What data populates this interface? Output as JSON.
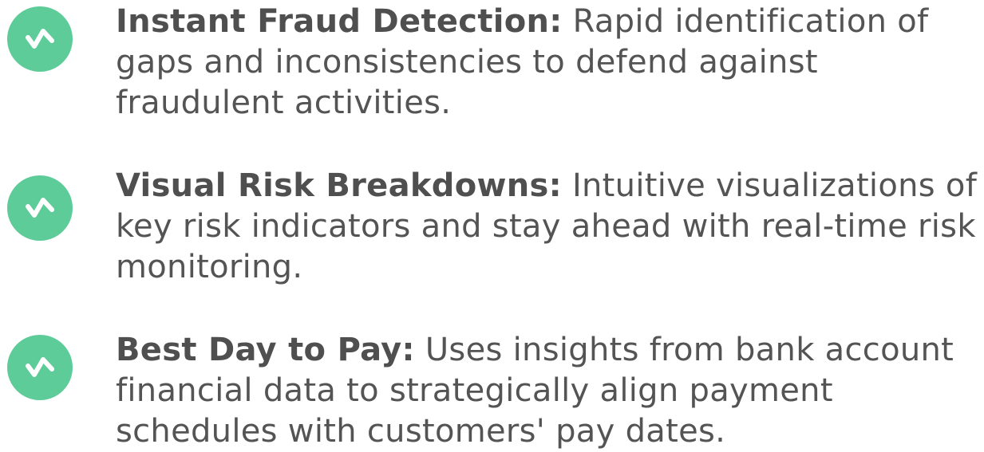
{
  "features": [
    {
      "icon": "checkmark-zigzag-icon",
      "title": "Instant Fraud Detection:",
      "description": "Rapid identification of gaps and inconsistencies to defend against fraudulent activities."
    },
    {
      "icon": "checkmark-zigzag-icon",
      "title": "Visual Risk Breakdowns:",
      "description": "Intuitive visualizations of key risk indicators and stay ahead with real-time risk monitoring."
    },
    {
      "icon": "checkmark-zigzag-icon",
      "title": "Best Day to Pay:",
      "description": "Uses insights from bank account financial data to strategically align payment schedules with customers' pay dates."
    }
  ],
  "colors": {
    "badge": "#5dcc99",
    "text": "#545454",
    "background": "#ffffff"
  }
}
